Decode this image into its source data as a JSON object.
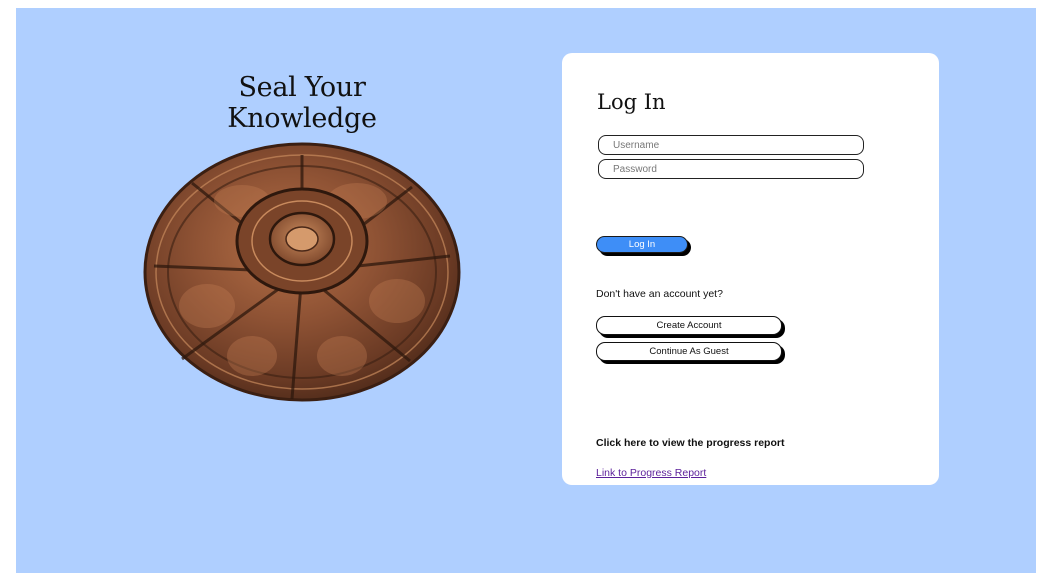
{
  "hero": {
    "title": "Seal Your Knowledge",
    "image_icon": "bronze-seal-medallion"
  },
  "login": {
    "title": "Log In",
    "username_placeholder": "Username",
    "password_placeholder": "Password",
    "login_label": "Log In",
    "no_account_prompt": "Don't have an account yet?",
    "create_account_label": "Create Account",
    "guest_label": "Continue As Guest",
    "report_heading": "Click here to view the progress report",
    "report_link_label": "Link to Progress Report"
  },
  "colors": {
    "background": "#afcfff",
    "card": "#ffffff",
    "accent": "#3e8ef7",
    "link": "#5b1f9a"
  }
}
